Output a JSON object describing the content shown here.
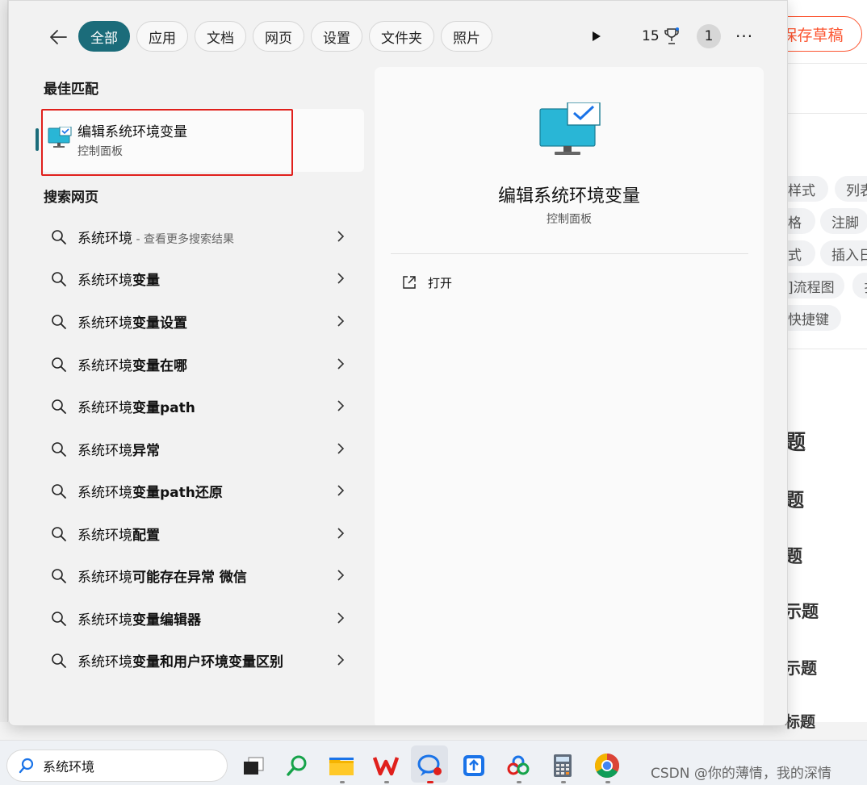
{
  "background_page": {
    "save_draft": "保存草稿",
    "tags": [
      "样式",
      "列表",
      "格",
      "注脚",
      "式",
      "插入日",
      "]流程图",
      "扌",
      "快捷键"
    ],
    "headings": [
      "题",
      "题",
      "题",
      "示题",
      "示题",
      "标题"
    ]
  },
  "search_panel": {
    "filters": [
      "全部",
      "应用",
      "文档",
      "网页",
      "设置",
      "文件夹",
      "照片"
    ],
    "active_filter": "全部",
    "rewards_count": "15",
    "badge": "1",
    "more": "···",
    "best_match_title": "最佳匹配",
    "best_match": {
      "title": "编辑系统环境变量",
      "subtitle": "控制面板"
    },
    "web_search_title": "搜索网页",
    "suggestions": [
      {
        "prefix": "系统环境",
        "bold": "",
        "hint": " - 查看更多搜索结果"
      },
      {
        "prefix": "系统环境",
        "bold": "变量",
        "hint": ""
      },
      {
        "prefix": "系统环境",
        "bold": "变量设置",
        "hint": ""
      },
      {
        "prefix": "系统环境",
        "bold": "变量在哪",
        "hint": ""
      },
      {
        "prefix": "系统环境",
        "bold": "变量path",
        "hint": ""
      },
      {
        "prefix": "系统环境",
        "bold": "异常",
        "hint": ""
      },
      {
        "prefix": "系统环境",
        "bold": "变量path还原",
        "hint": ""
      },
      {
        "prefix": "系统环境",
        "bold": "配置",
        "hint": ""
      },
      {
        "prefix": "系统环境",
        "bold": "可能存在异常 微信",
        "hint": ""
      },
      {
        "prefix": "系统环境",
        "bold": "变量编辑器",
        "hint": ""
      },
      {
        "prefix": "系统环境",
        "bold": "变量和用户环境变量区别",
        "hint": ""
      }
    ],
    "detail": {
      "title": "编辑系统环境变量",
      "subtitle": "控制面板",
      "open_label": "打开"
    }
  },
  "taskbar": {
    "search_value": "系统环境",
    "apps": [
      "task-view-icon",
      "search-app-icon",
      "file-explorer-icon",
      "wps-icon",
      "chat-app-icon",
      "upload-app-icon",
      "cloud-drive-icon",
      "calculator-icon",
      "chrome-icon"
    ]
  },
  "watermark": "CSDN @你的薄情，我的深情"
}
